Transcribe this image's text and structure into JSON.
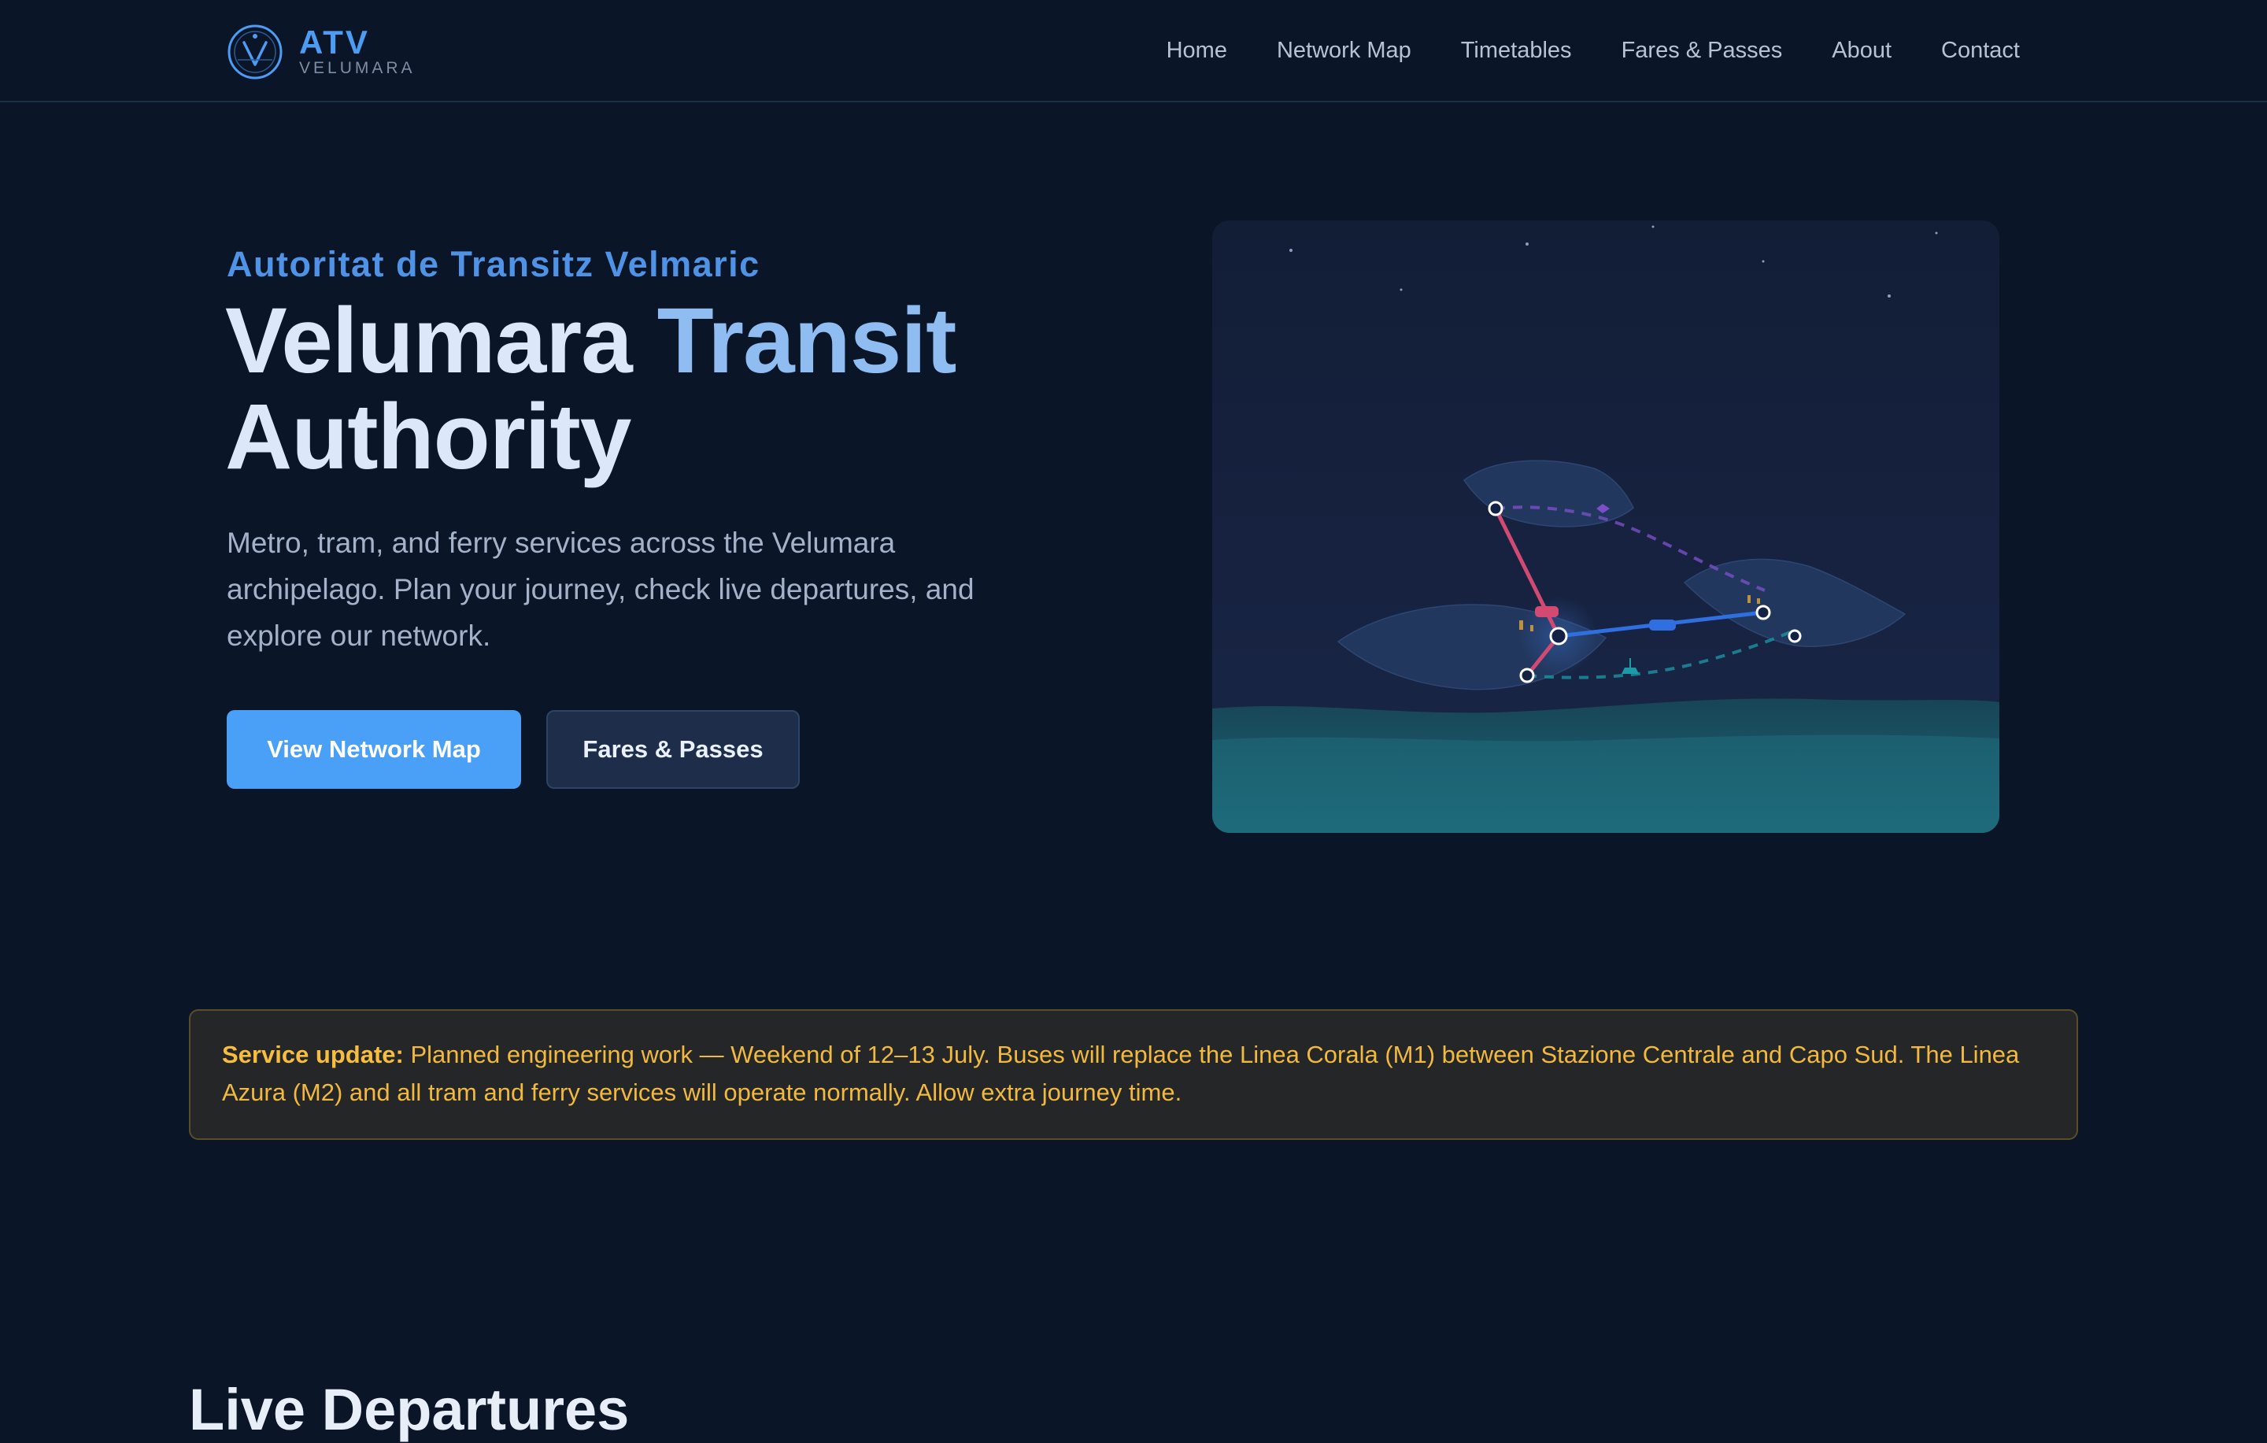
{
  "brand": {
    "name": "ATV",
    "subtitle": "VELUMARA",
    "logo_icon": "compass-v-icon"
  },
  "nav": {
    "items": [
      {
        "label": "Home"
      },
      {
        "label": "Network Map"
      },
      {
        "label": "Timetables"
      },
      {
        "label": "Fares & Passes"
      },
      {
        "label": "About"
      },
      {
        "label": "Contact"
      }
    ]
  },
  "hero": {
    "eyebrow": "Autoritat de Transitz Velmaric",
    "title_part1": "Velumara Transit",
    "title_part2": "Authority",
    "lead": "Metro, tram, and ferry services across the Velumara archipelago. Plan your journey, check live departures, and explore our network.",
    "primary_button": "View Network Map",
    "secondary_button": "Fares & Passes",
    "illustration": "archipelago-network-illustration"
  },
  "service_update": {
    "label": "Service update:",
    "text": " Planned engineering work — Weekend of 12–13 July. Buses will replace the Linea Corala (M1) between Stazione Centrale and Capo Sud. The Linea Azura (M2) and all tram and ferry services will operate normally. Allow extra journey time."
  },
  "live_departures": {
    "title": "Live Departures"
  },
  "colors": {
    "background": "#0b1528",
    "accent": "#4aa0f7",
    "warning": "#f2b93f",
    "line_coral": "#d24a72",
    "line_azure": "#2f6fe0",
    "line_ferry": "#1c9aa8",
    "line_tram": "#7a4fc7"
  }
}
